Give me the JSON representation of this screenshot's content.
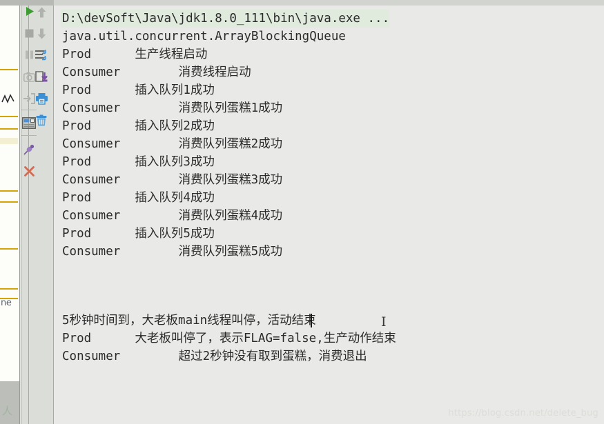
{
  "colors": {
    "console_bg": "#e9eae7",
    "toolbar_bg": "#dbddd9",
    "highlight_line_bg": "#e0eadd",
    "text": "#2b2b2b",
    "run_green": "#3f9c35",
    "close_red": "#d9694e",
    "icon_blue": "#3b8fd4",
    "pin_purple": "#8060a8",
    "watermark": "#dcddd9"
  },
  "toolbar": {
    "column_left": [
      {
        "name": "rerun-button",
        "icon": "play-icon",
        "label": "Rerun"
      },
      {
        "name": "stop-button",
        "icon": "stop-icon",
        "label": "Stop"
      },
      {
        "name": "pause-button",
        "icon": "pause-icon",
        "label": "Pause Output"
      },
      {
        "name": "dump-threads-button",
        "icon": "camera-icon",
        "label": "Dump Threads"
      },
      {
        "name": "exit-button",
        "icon": "exit-arrow-icon",
        "label": "Exit"
      },
      {
        "name": "layout-button",
        "icon": "layout-icon",
        "label": "Layout Settings"
      },
      {
        "name": "pin-tab-button",
        "icon": "pin-icon",
        "label": "Pin Tab"
      },
      {
        "name": "close-button",
        "icon": "close-x-icon",
        "label": "Close"
      }
    ],
    "column_right": [
      {
        "name": "up-button",
        "icon": "arrow-up-icon",
        "label": "Up the Stack Trace"
      },
      {
        "name": "down-button",
        "icon": "arrow-down-icon",
        "label": "Down the Stack Trace"
      },
      {
        "name": "soft-wrap-button",
        "icon": "soft-wrap-icon",
        "label": "Soft-Wrap"
      },
      {
        "name": "export-button",
        "icon": "save-to-file-icon",
        "label": "Export to Text File"
      },
      {
        "name": "print-button",
        "icon": "print-icon",
        "label": "Print"
      },
      {
        "name": "clear-all-button",
        "icon": "trash-icon",
        "label": "Clear All"
      }
    ]
  },
  "editor_strip": {
    "visible_text": "ne"
  },
  "console": {
    "lines": [
      {
        "text": "D:\\devSoft\\Java\\jdk1.8.0_111\\bin\\java.exe ...",
        "highlight": true
      },
      {
        "text": "java.util.concurrent.ArrayBlockingQueue",
        "highlight": false
      },
      {
        "text": "Prod      生产线程启动",
        "highlight": false
      },
      {
        "text": "Consumer        消费线程启动",
        "highlight": false
      },
      {
        "text": "Prod      插入队列1成功",
        "highlight": false
      },
      {
        "text": "Consumer        消费队列蛋糕1成功",
        "highlight": false
      },
      {
        "text": "Prod      插入队列2成功",
        "highlight": false
      },
      {
        "text": "Consumer        消费队列蛋糕2成功",
        "highlight": false
      },
      {
        "text": "Prod      插入队列3成功",
        "highlight": false
      },
      {
        "text": "Consumer        消费队列蛋糕3成功",
        "highlight": false
      },
      {
        "text": "Prod      插入队列4成功",
        "highlight": false
      },
      {
        "text": "Consumer        消费队列蛋糕4成功",
        "highlight": false
      },
      {
        "text": "Prod      插入队列5成功",
        "highlight": false
      },
      {
        "text": "Consumer        消费队列蛋糕5成功",
        "highlight": false
      }
    ],
    "lines_bottom": [
      {
        "text": "5秒钟时间到，大老板main线程叫停，活动结束"
      },
      {
        "text": "Prod      大老板叫停了，表示FLAG=false,生产动作结束"
      },
      {
        "text": "Consumer        超过2秒钟没有取到蛋糕，消费退出"
      }
    ]
  },
  "watermark": {
    "text": "https://blog.csdn.net/delete_bug"
  },
  "cursor": {
    "ibeam_glyph": "I"
  }
}
